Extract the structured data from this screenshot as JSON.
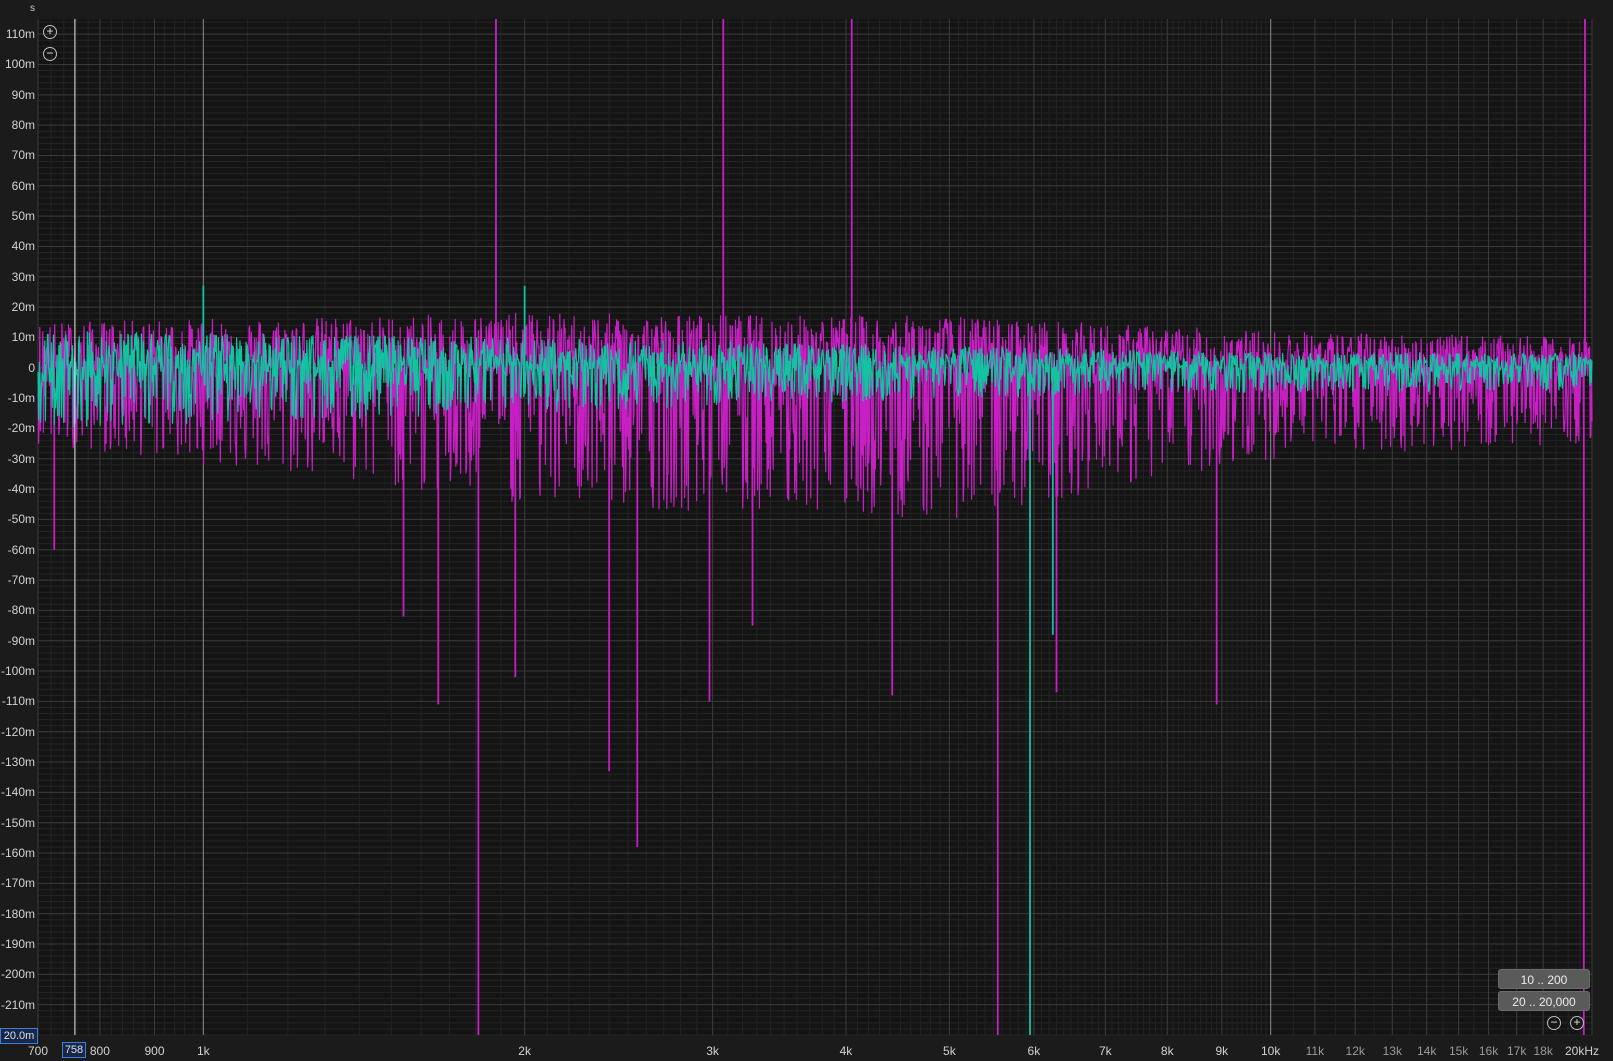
{
  "top_unit_label": "s",
  "cursor": {
    "x_readout": "758",
    "y_readout": "20.0m"
  },
  "range_buttons": {
    "low": "10 .. 200",
    "full": "20 .. 20,000"
  },
  "colors": {
    "background": "#1b1b1b",
    "grid": "#3a3a3a",
    "series_magenta": "#c71fc3",
    "series_teal": "#12c2a0",
    "cursor_line": "#e6e6e6"
  },
  "icons": [
    "zoom-in-icon",
    "zoom-out-icon"
  ],
  "chart_data": {
    "type": "line",
    "title": "",
    "xlabel": "",
    "ylabel": "",
    "x_scale": "log",
    "xlim": [
      700,
      20000
    ],
    "ylim": [
      -220,
      115
    ],
    "x_unit_label": "20kHz",
    "cursor_x_value": 758,
    "grid": true,
    "x_tick_values": [
      700,
      800,
      900,
      1000,
      2000,
      3000,
      4000,
      5000,
      6000,
      7000,
      8000,
      9000,
      10000,
      11000,
      12000,
      13000,
      14000,
      15000,
      16000,
      17000,
      18000,
      20000
    ],
    "x_tick_labels": [
      "700",
      "800",
      "900",
      "1k",
      "2k",
      "3k",
      "4k",
      "5k",
      "6k",
      "7k",
      "8k",
      "9k",
      "10k",
      "11k",
      "12k",
      "13k",
      "14k",
      "15k",
      "16k",
      "17k",
      "18k",
      "20kHz"
    ],
    "y_tick_values": [
      110,
      100,
      90,
      80,
      70,
      60,
      50,
      40,
      30,
      20,
      10,
      0,
      -10,
      -20,
      -30,
      -40,
      -50,
      -60,
      -70,
      -80,
      -90,
      -100,
      -110,
      -120,
      -130,
      -140,
      -150,
      -160,
      -170,
      -180,
      -190,
      -200,
      -210
    ],
    "y_tick_labels": [
      "110m",
      "100m",
      "90m",
      "80m",
      "70m",
      "60m",
      "50m",
      "40m",
      "30m",
      "20m",
      "10m",
      "0",
      "-10m",
      "-20m",
      "-30m",
      "-40m",
      "-50m",
      "-60m",
      "-70m",
      "-80m",
      "-90m",
      "-100m",
      "-110m",
      "-120m",
      "-130m",
      "-140m",
      "-150m",
      "-160m",
      "-170m",
      "-180m",
      "-190m",
      "-200m",
      "-210m"
    ],
    "series": [
      {
        "color": "#c71fc3",
        "spikes": [
          {
            "x": 1880,
            "y": 120
          },
          {
            "x": 3070,
            "y": 120
          },
          {
            "x": 4050,
            "y": 120
          },
          {
            "x": 19700,
            "y": 120
          },
          {
            "x": 1810,
            "y": -225
          },
          {
            "x": 5550,
            "y": -225
          },
          {
            "x": 19650,
            "y": -225
          },
          {
            "x": 1960,
            "y": -102
          },
          {
            "x": 2400,
            "y": -133
          },
          {
            "x": 2550,
            "y": -158
          },
          {
            "x": 2980,
            "y": -110
          },
          {
            "x": 3270,
            "y": -85
          },
          {
            "x": 1660,
            "y": -111
          },
          {
            "x": 1540,
            "y": -82
          },
          {
            "x": 4420,
            "y": -108
          },
          {
            "x": 6300,
            "y": -107
          },
          {
            "x": 8900,
            "y": -111
          },
          {
            "x": 725,
            "y": -60
          }
        ],
        "noise_band": [
          [
            700,
            15,
            -25
          ],
          [
            2000,
            18,
            -45
          ],
          [
            5000,
            17,
            -50
          ],
          [
            10000,
            12,
            -30
          ],
          [
            19000,
            10,
            -25
          ]
        ]
      },
      {
        "color": "#12c2a0",
        "spikes": [
          {
            "x": 5950,
            "y": -225
          },
          {
            "x": 6250,
            "y": -88
          },
          {
            "x": 1000,
            "y": 27
          },
          {
            "x": 2000,
            "y": 27
          }
        ],
        "noise_band": [
          [
            700,
            12,
            -20
          ],
          [
            2000,
            10,
            -15
          ],
          [
            5000,
            7,
            -10
          ],
          [
            10000,
            5,
            -8
          ],
          [
            19000,
            5,
            -8
          ]
        ]
      }
    ]
  }
}
